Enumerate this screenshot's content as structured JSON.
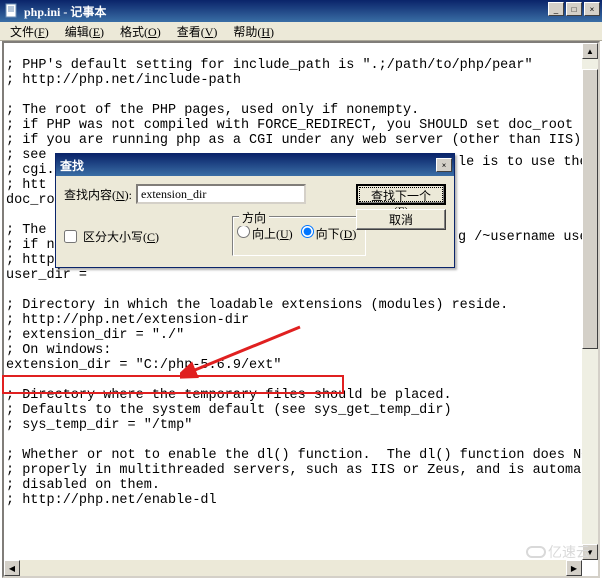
{
  "window": {
    "title": "php.ini - 记事本",
    "buttons": {
      "min": "_",
      "max": "□",
      "close": "×"
    }
  },
  "menu": {
    "file": {
      "label": "文件(",
      "hot": "F",
      "tail": ")"
    },
    "edit": {
      "label": "编辑(",
      "hot": "E",
      "tail": ")"
    },
    "format": {
      "label": "格式(",
      "hot": "O",
      "tail": ")"
    },
    "view": {
      "label": "查看(",
      "hot": "V",
      "tail": ")"
    },
    "help": {
      "label": "帮助(",
      "hot": "H",
      "tail": ")"
    }
  },
  "editor": {
    "content": "\n; PHP's default setting for include_path is \".;/path/to/php/pear\"\n; http://php.net/include-path\n\n; The root of the PHP pages, used only if nonempty.\n; if PHP was not compiled with FORCE_REDIRECT, you SHOULD set doc_root\n; if you are running php as a CGI under any web server (other than IIS)\n; see\n; cgi.\n; htt\ndoc_ro\n\n; The\n; if n\n; http://php.net/user-dir\nuser_dir =\n\n; Directory in which the loadable extensions (modules) reside.\n; http://php.net/extension-dir\n; extension_dir = \"./\"\n; On windows:\nextension_dir = \"C:/php-5.6.9/ext\"\n\n; Directory where the temporary files should be placed.\n; Defaults to the system default (see sys_get_temp_dir)\n; sys_temp_dir = \"/tmp\"\n\n; Whether or not to enable the dl() function.  The dl() function does NO\n; properly in multithreaded servers, such as IIS or Zeus, and is automat\n; disabled on them.\n; http://php.net/enable-dl",
    "overlay_right": {
      "line7": "le is to use the",
      "line12": "g /~username used o"
    }
  },
  "find_dialog": {
    "title": "查找",
    "close": "×",
    "content_label_pre": "查找内容(",
    "content_label_hot": "N",
    "content_label_post": "):",
    "input_value": "extension_dir",
    "case_label_pre": "区分大小写(",
    "case_label_hot": "C",
    "case_label_post": ")",
    "direction_legend": "方向",
    "up_pre": "向上(",
    "up_hot": "U",
    "up_post": ")",
    "down_pre": "向下(",
    "down_hot": "D",
    "down_post": ")",
    "find_next_pre": "查找下一个(",
    "find_next_hot": "F",
    "find_next_post": ")",
    "cancel": "取消"
  },
  "annotation": {
    "highlight_target": "extension_dir = \"C:/php-5.6.9/ext\"",
    "arrow_color": "#e02020"
  },
  "watermark": {
    "text": "亿速云"
  }
}
